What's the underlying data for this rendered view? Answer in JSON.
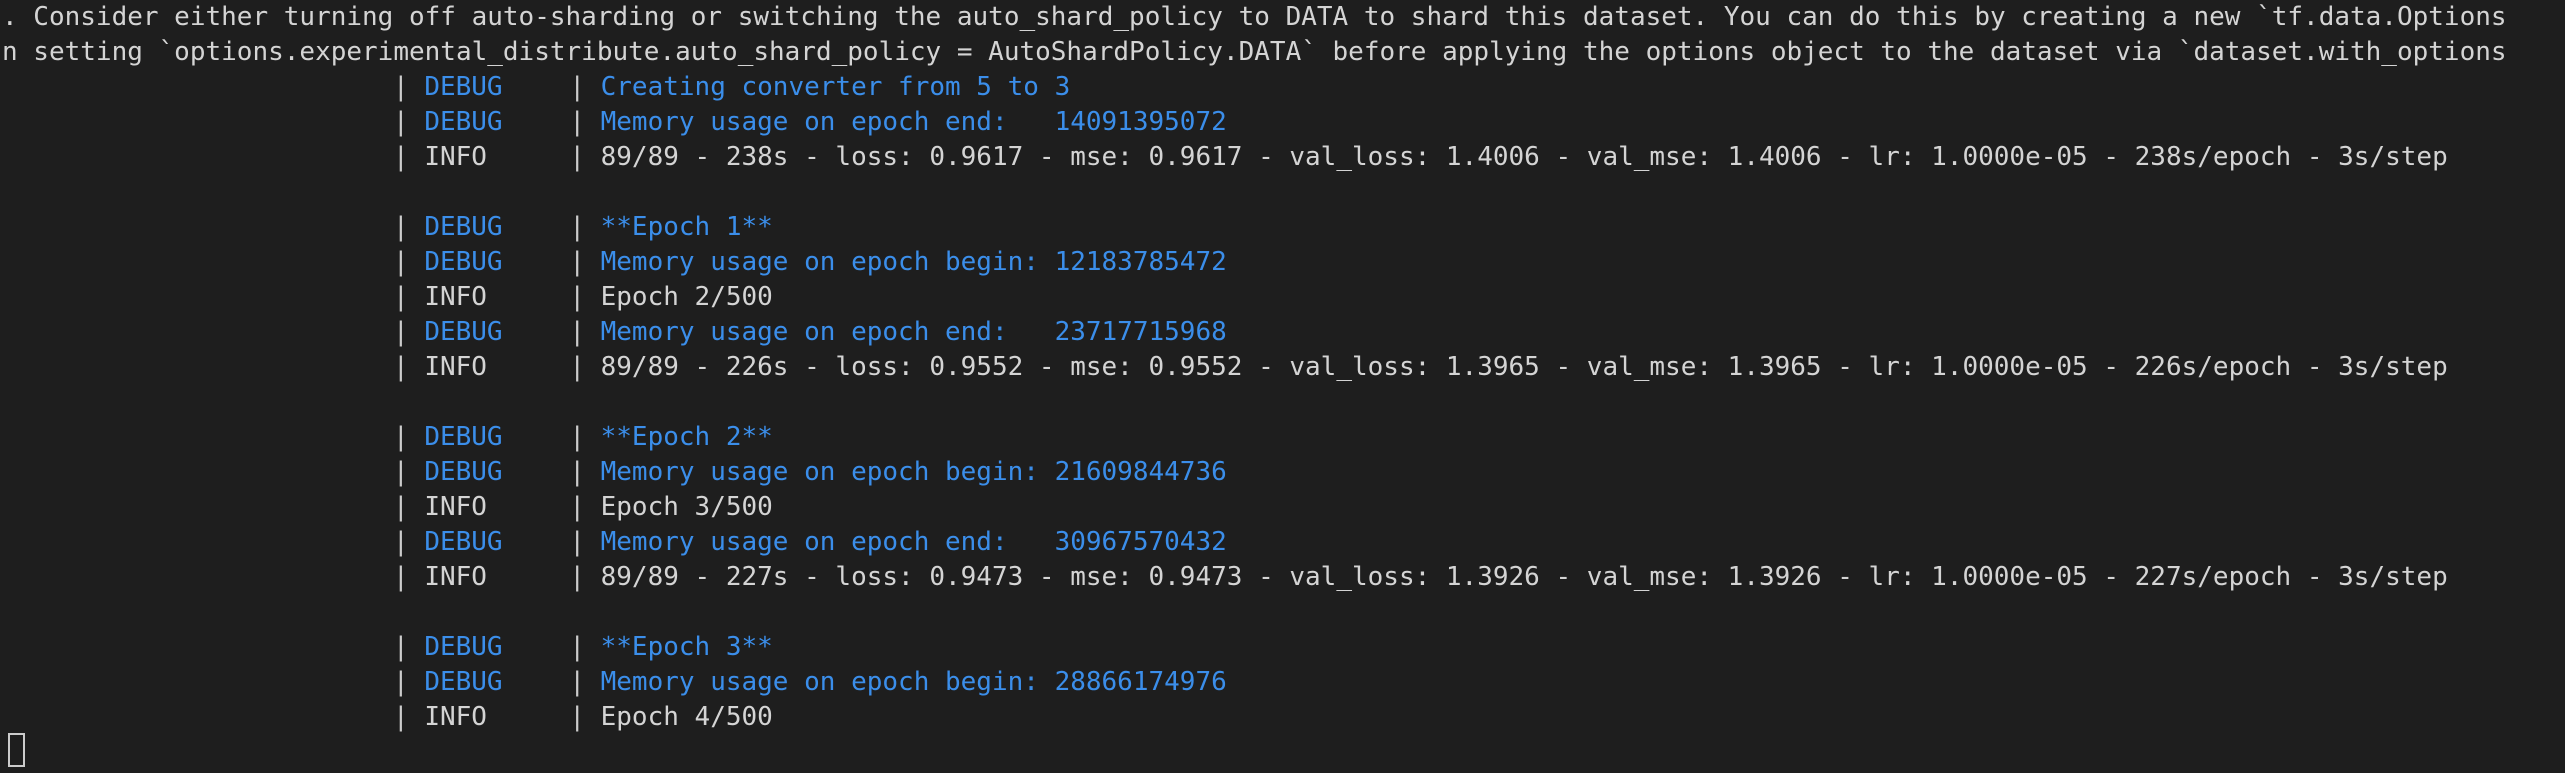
{
  "header_lines": [
    ". Consider either turning off auto-sharding or switching the auto_shard_policy to DATA to shard this dataset. You can do this by creating a new `tf.data.Options",
    "n setting `options.experimental_distribute.auto_shard_policy = AutoShardPolicy.DATA` before applying the options object to the dataset via `dataset.with_options"
  ],
  "separator": "|",
  "log_lines": [
    {
      "level": "DEBUG",
      "message": "Creating converter from 5 to 3"
    },
    {
      "level": "DEBUG",
      "message": "Memory usage on epoch end:   14091395072"
    },
    {
      "level": "INFO",
      "message": "89/89 - 238s - loss: 0.9617 - mse: 0.9617 - val_loss: 1.4006 - val_mse: 1.4006 - lr: 1.0000e-05 - 238s/epoch - 3s/step"
    },
    {
      "blank": true
    },
    {
      "level": "DEBUG",
      "message": "**Epoch 1**"
    },
    {
      "level": "DEBUG",
      "message": "Memory usage on epoch begin: 12183785472"
    },
    {
      "level": "INFO",
      "message": "Epoch 2/500"
    },
    {
      "level": "DEBUG",
      "message": "Memory usage on epoch end:   23717715968"
    },
    {
      "level": "INFO",
      "message": "89/89 - 226s - loss: 0.9552 - mse: 0.9552 - val_loss: 1.3965 - val_mse: 1.3965 - lr: 1.0000e-05 - 226s/epoch - 3s/step"
    },
    {
      "blank": true
    },
    {
      "level": "DEBUG",
      "message": "**Epoch 2**"
    },
    {
      "level": "DEBUG",
      "message": "Memory usage on epoch begin: 21609844736"
    },
    {
      "level": "INFO",
      "message": "Epoch 3/500"
    },
    {
      "level": "DEBUG",
      "message": "Memory usage on epoch end:   30967570432"
    },
    {
      "level": "INFO",
      "message": "89/89 - 227s - loss: 0.9473 - mse: 0.9473 - val_loss: 1.3926 - val_mse: 1.3926 - lr: 1.0000e-05 - 227s/epoch - 3s/step"
    },
    {
      "blank": true
    },
    {
      "level": "DEBUG",
      "message": "**Epoch 3**"
    },
    {
      "level": "DEBUG",
      "message": "Memory usage on epoch begin: 28866174976"
    },
    {
      "level": "INFO",
      "message": "Epoch 4/500"
    }
  ],
  "colors": {
    "background": "#1e1e1e",
    "debug": "#3b8eea",
    "info": "#d4d4d4",
    "separator": "#cccccc"
  }
}
